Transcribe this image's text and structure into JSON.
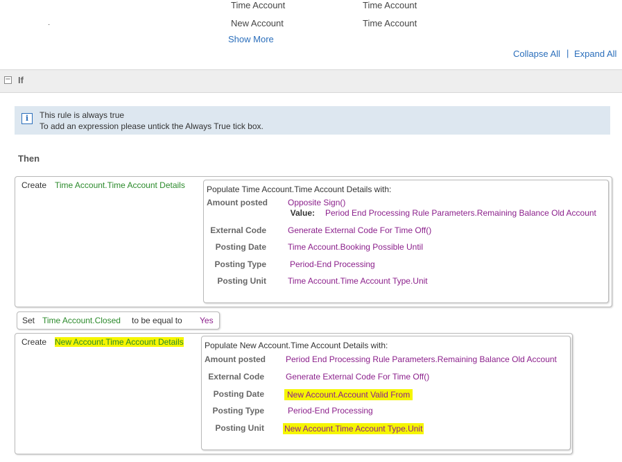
{
  "top_rows": [
    {
      "col1": "Time Account",
      "col2": "Time Account"
    },
    {
      "col1": "New Account",
      "col2": "Time Account"
    }
  ],
  "show_more": "Show More",
  "collapse_all": "Collapse All",
  "separator": "|",
  "expand_all": "Expand All",
  "if_section": {
    "label": "If",
    "toggle": "−"
  },
  "info": {
    "icon": "i",
    "line1": "This rule is always true",
    "line2": "To add an expression please untick the Always True tick box."
  },
  "then_label": "Then",
  "actions": {
    "create1": {
      "keyword": "Create",
      "target": "Time Account.Time Account Details",
      "header": "Populate Time Account.Time Account Details with:",
      "fields": {
        "amount_label": "Amount posted",
        "amount_value": "Opposite Sign()",
        "value_label": "Value:",
        "value_value": "Period End Processing Rule Parameters.Remaining Balance Old Account",
        "external_code_label": "External Code",
        "external_code_value": "Generate External Code For Time Off()",
        "posting_date_label": "Posting Date",
        "posting_date_value": "Time Account.Booking Possible Until",
        "posting_type_label": "Posting Type",
        "posting_type_value": "Period-End Processing",
        "posting_unit_label": "Posting Unit",
        "posting_unit_value": "Time Account.Time Account Type.Unit"
      }
    },
    "set": {
      "keyword": "Set",
      "target": "Time Account.Closed",
      "middle": "to be equal to",
      "value": "Yes"
    },
    "create2": {
      "keyword": "Create",
      "target": "New Account.Time Account Details",
      "header": "Populate New Account.Time Account Details with:",
      "fields": {
        "amount_label": "Amount posted",
        "amount_value": "Period End Processing Rule Parameters.Remaining Balance Old Account",
        "external_code_label": "External Code",
        "external_code_value": "Generate External Code For Time Off()",
        "posting_date_label": "Posting Date",
        "posting_date_value": "New Account.Account Valid From",
        "posting_type_label": "Posting Type",
        "posting_type_value": "Period-End Processing",
        "posting_unit_label": "Posting Unit",
        "posting_unit_value": "New Account.Time Account Type.Unit"
      }
    }
  },
  "colors": {
    "green": "#2b8a2b",
    "purple": "#8b1f8b",
    "link": "#2a6ebb",
    "highlight": "#f5f500"
  }
}
